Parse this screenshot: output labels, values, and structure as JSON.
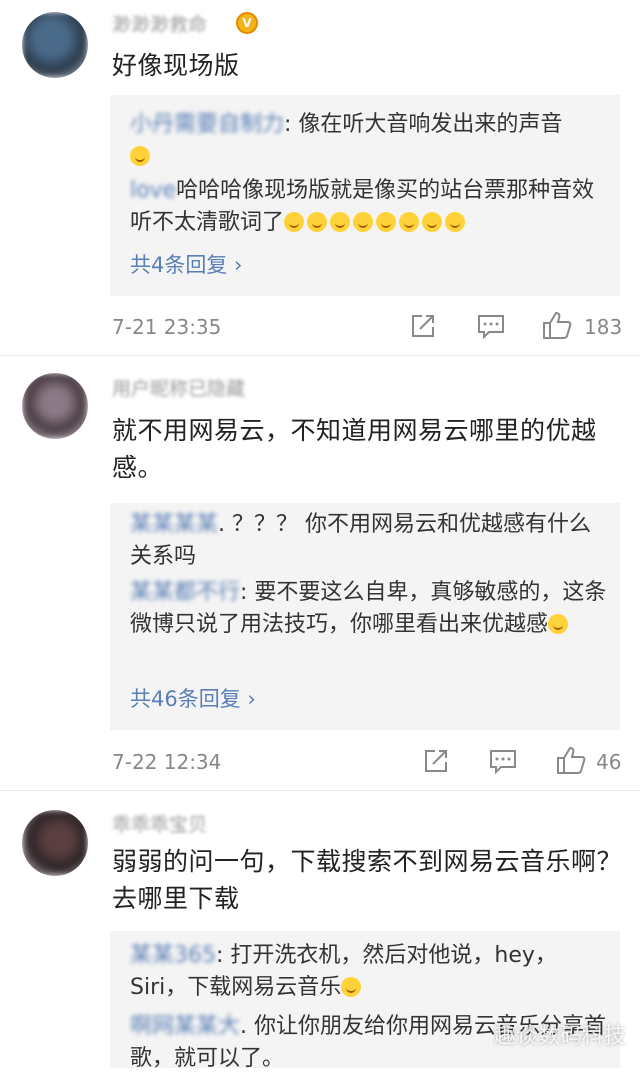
{
  "comments": [
    {
      "username": "渺渺渺救命",
      "text": "好像现场版",
      "replies": [
        {
          "who": "小丹需要自制力",
          "text": ": 像在听大音响发出来的声音"
        },
        {
          "who": "love",
          "text": "哈哈哈像现场版就是像买的站台票那种音效听不太清歌词了"
        }
      ],
      "more": "共4条回复 ›",
      "time": "7-21 23:35",
      "likes": "183"
    },
    {
      "username": "用户昵称已隐藏",
      "text": "就不用网易云，不知道用网易云哪里的优越感。",
      "replies": [
        {
          "who": "某某某某",
          "text": ". ？？？ 你不用网易云和优越感有什么关系吗"
        },
        {
          "who": "某某都不行",
          "text": ": 要不要这么自卑，真够敏感的，这条微博只说了用法技巧，你哪里看出来优越感"
        }
      ],
      "more": "共46条回复 ›",
      "time": "7-22 12:34",
      "likes": "46"
    },
    {
      "username": "乖乖乖宝贝",
      "text": "弱弱的问一句，下载搜索不到网易云音乐啊？去哪里下载",
      "replies": [
        {
          "who": "某某365",
          "text": ": 打开洗衣机，然后对他说，hey，Siri，下载网易云音乐"
        },
        {
          "who": "啊网某某大",
          "text": ". 你让你朋友给你用网易云音乐分享首歌，就可以了。"
        }
      ]
    }
  ],
  "watermark": "趣谈数码科技",
  "colors": {
    "link": "#5a7fb6",
    "meta": "#888888",
    "reply_bg": "#f4f4f4"
  }
}
